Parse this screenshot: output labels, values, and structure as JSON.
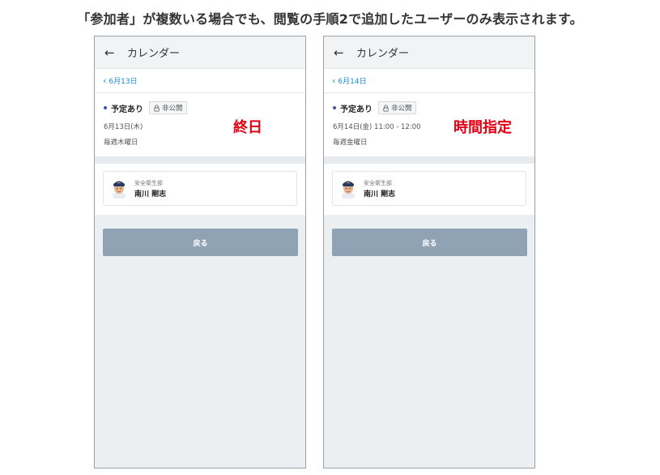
{
  "caption": "「参加者」が複数いる場合でも、閲覧の手順2で追加したユーザーのみ表示されます。",
  "colors": {
    "accent_link": "#1a8cd8",
    "annotation_red": "#e60012",
    "button_bg": "#90a3b4"
  },
  "screens": [
    {
      "topbar": {
        "back_icon": "arrow-left-icon",
        "title": "カレンダー"
      },
      "date_nav": {
        "icon": "chevron-left-icon",
        "label": "6月13日"
      },
      "event": {
        "title": "予定あり",
        "visibility": "非公開",
        "date": "6月13日(木)",
        "repeat": "毎週木曜日"
      },
      "annotation": "終日",
      "participant": {
        "department": "安全衛生部",
        "name": "南川 剛志"
      },
      "button_label": "戻る"
    },
    {
      "topbar": {
        "back_icon": "arrow-left-icon",
        "title": "カレンダー"
      },
      "date_nav": {
        "icon": "chevron-left-icon",
        "label": "6月14日"
      },
      "event": {
        "title": "予定あり",
        "visibility": "非公開",
        "date": "6月14日(金) 11:00 - 12:00",
        "repeat": "毎週金曜日"
      },
      "annotation": "時間指定",
      "participant": {
        "department": "安全衛生部",
        "name": "南川 剛志"
      },
      "button_label": "戻る"
    }
  ]
}
